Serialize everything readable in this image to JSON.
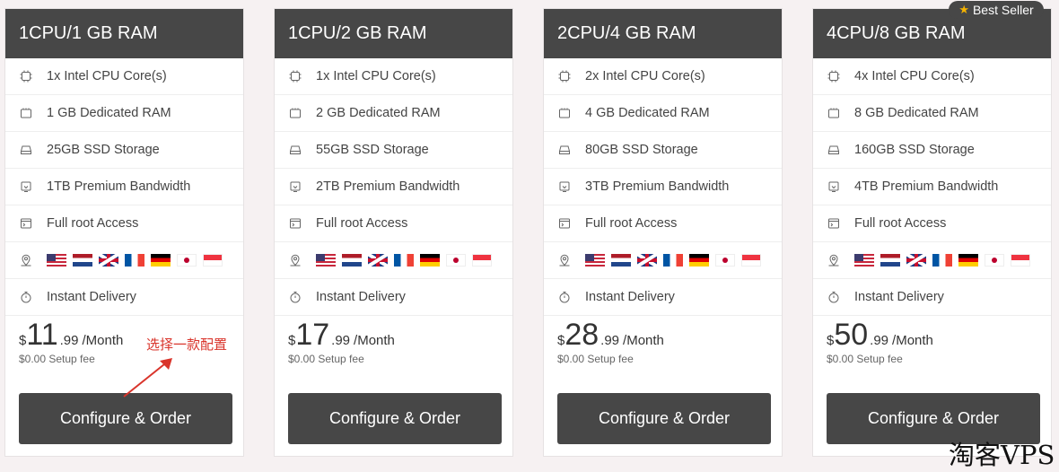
{
  "plans": [
    {
      "title": "1CPU/1 GB RAM",
      "features": [
        "1x Intel CPU Core(s)",
        "1 GB Dedicated RAM",
        "25GB SSD Storage",
        "1TB Premium Bandwidth",
        "Full root Access"
      ],
      "delivery": "Instant Delivery",
      "currency": "$",
      "amount": "11",
      "cents": ".99",
      "period": "/Month",
      "setup_fee": "$0.00 Setup fee",
      "button": "Configure & Order"
    },
    {
      "title": "1CPU/2 GB RAM",
      "features": [
        "1x Intel CPU Core(s)",
        "2 GB Dedicated RAM",
        "55GB SSD Storage",
        "2TB Premium Bandwidth",
        "Full root Access"
      ],
      "delivery": "Instant Delivery",
      "currency": "$",
      "amount": "17",
      "cents": ".99",
      "period": "/Month",
      "setup_fee": "$0.00 Setup fee",
      "button": "Configure & Order"
    },
    {
      "title": "2CPU/4 GB RAM",
      "features": [
        "2x Intel CPU Core(s)",
        "4 GB Dedicated RAM",
        "80GB SSD Storage",
        "3TB Premium Bandwidth",
        "Full root Access"
      ],
      "delivery": "Instant Delivery",
      "currency": "$",
      "amount": "28",
      "cents": ".99",
      "period": "/Month",
      "setup_fee": "$0.00 Setup fee",
      "button": "Configure & Order"
    },
    {
      "title": "4CPU/8 GB RAM",
      "features": [
        "4x Intel CPU Core(s)",
        "8 GB Dedicated RAM",
        "160GB SSD Storage",
        "4TB Premium Bandwidth",
        "Full root Access"
      ],
      "delivery": "Instant Delivery",
      "currency": "$",
      "amount": "50",
      "cents": ".99",
      "period": "/Month",
      "setup_fee": "$0.00 Setup fee",
      "button": "Configure & Order"
    }
  ],
  "flags": [
    "us",
    "nl",
    "uk",
    "fr",
    "de",
    "jp",
    "sg"
  ],
  "feature_icons": [
    "cpu-icon",
    "ram-icon",
    "storage-icon",
    "bandwidth-icon",
    "terminal-icon"
  ],
  "badge": {
    "label": "Best Seller",
    "icon": "star-icon"
  },
  "annotation": "选择一款配置",
  "watermark": "淘客VPS",
  "colors": {
    "header": "#474747",
    "button": "#474747",
    "annotation": "#d9342b",
    "badge_star": "#f5b301"
  }
}
